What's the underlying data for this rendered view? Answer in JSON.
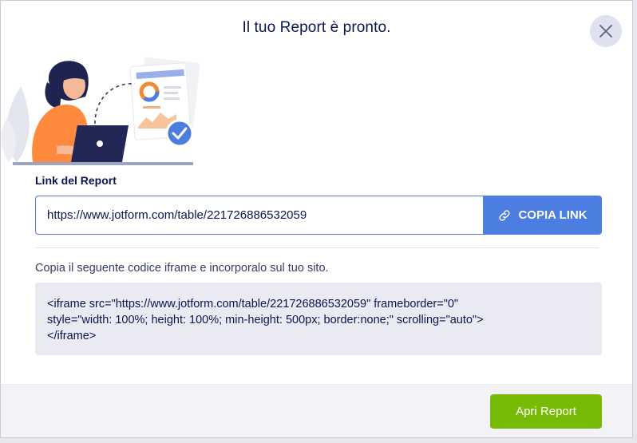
{
  "dialog": {
    "title": "Il tuo Report è pronto."
  },
  "link_section": {
    "label": "Link del Report",
    "url": "https://www.jotform.com/table/221726886532059",
    "copy_label": "COPIA LINK"
  },
  "iframe_section": {
    "hint": "Copia il seguente codice iframe e incorporalo sul tuo sito.",
    "code": "<iframe src=\"https://www.jotform.com/table/221726886532059\" frameborder=\"0\"\nstyle=\"width: 100%; height: 100%; min-height: 500px; border:none;\" scrolling=\"auto\">\n</iframe>"
  },
  "footer": {
    "open_label": "Apri Report"
  },
  "colors": {
    "primary_blue": "#4c7de0",
    "green": "#78bb07",
    "navy": "#0a1551",
    "orange": "#ff8a3d"
  },
  "icons": {
    "close": "close-icon",
    "link": "link-icon",
    "check": "check-circle-icon"
  }
}
